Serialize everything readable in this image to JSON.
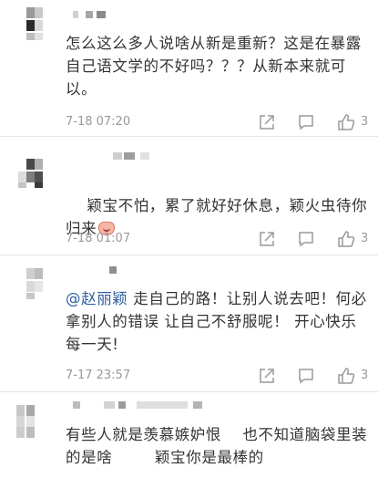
{
  "comments": [
    {
      "text": "怎么这么多人说啥从新是重新？这是在暴露自己语文学的不好吗？？？从新本来就可以。",
      "time": "7-18 07:20",
      "likes": "3"
    },
    {
      "text": "颖宝不怕，累了就好好休息，颖火虫待你归来",
      "time": "7-18 01:07",
      "likes": "3"
    },
    {
      "mention": "@赵丽颖",
      "text": " 走自己的路！让别人说去吧！何必拿别人的错误 让自己不舒服呢！ 开心快乐每一天!",
      "time": "7-17 23:57",
      "likes": "3"
    },
    {
      "text": "有些人就是羡慕嫉妒恨    也不知道脑袋里装的是啥        颖宝你是最棒的"
    }
  ],
  "icons": {
    "share": "share-icon",
    "comment": "comment-icon",
    "like": "thumbs-up-icon"
  },
  "colors": {
    "text": "#333333",
    "meta": "#999999",
    "mention": "#2f5f9e",
    "divider": "#e6e6e6"
  }
}
